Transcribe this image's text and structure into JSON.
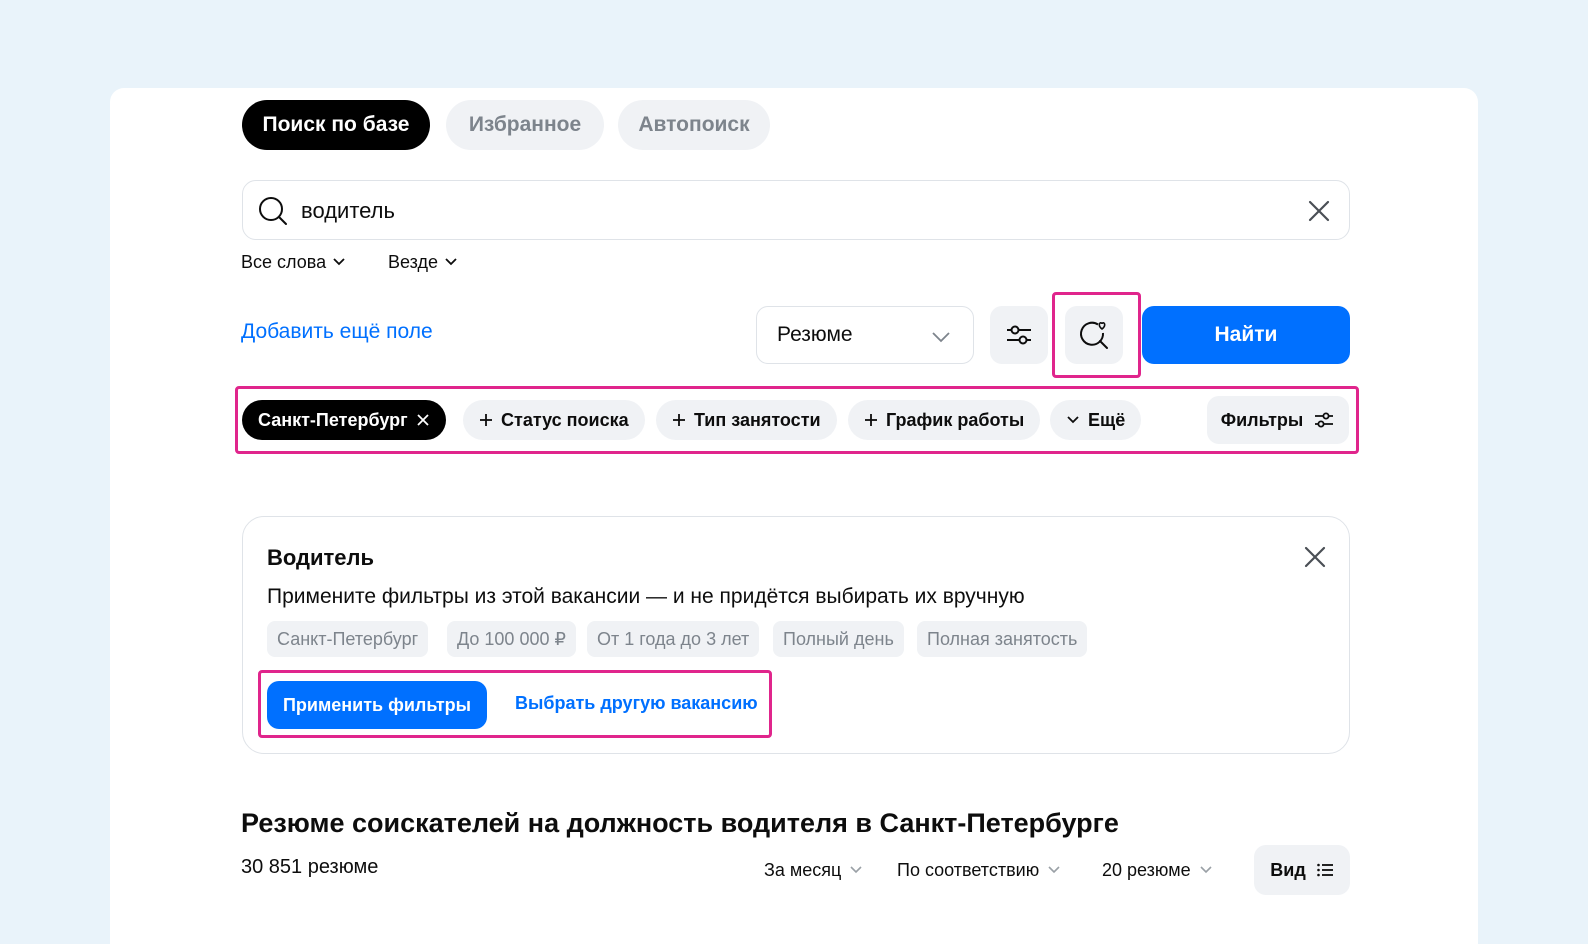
{
  "tabs": [
    {
      "label": "Поиск по базе",
      "active": true
    },
    {
      "label": "Избранное",
      "active": false
    },
    {
      "label": "Автопоиск",
      "active": false
    }
  ],
  "search": {
    "value": "водитель",
    "word_mode": "Все слова",
    "scope": "Везде"
  },
  "actions": {
    "add_field": "Добавить ещё поле",
    "type_select": "Резюме",
    "find_button": "Найти"
  },
  "chips": {
    "city": "Санкт-Петербург",
    "items": [
      "Статус поиска",
      "Тип занятости",
      "График работы"
    ],
    "more": "Ещё",
    "filters": "Фильтры"
  },
  "vacancy": {
    "title": "Водитель",
    "subtitle": "Примените фильтры из этой вакансии — и не придётся выбирать их вручную",
    "tags": [
      "Санкт-Петербург",
      "До 100 000 ₽",
      "От 1 года до 3 лет",
      "Полный день",
      "Полная занятость"
    ],
    "apply_button": "Применить фильтры",
    "other_link": "Выбрать другую вакансию"
  },
  "results": {
    "title": "Резюме соискателей на должность водителя в Санкт-Петербурге",
    "count": "30 851 резюме",
    "period": "За месяц",
    "sort": "По соответствию",
    "per_page": "20 резюме",
    "view": "Вид"
  },
  "colors": {
    "accent": "#0070ff",
    "highlight": "#e0258c",
    "chip_bg": "#f0f2f5",
    "page_bg": "#e9f3fa"
  }
}
